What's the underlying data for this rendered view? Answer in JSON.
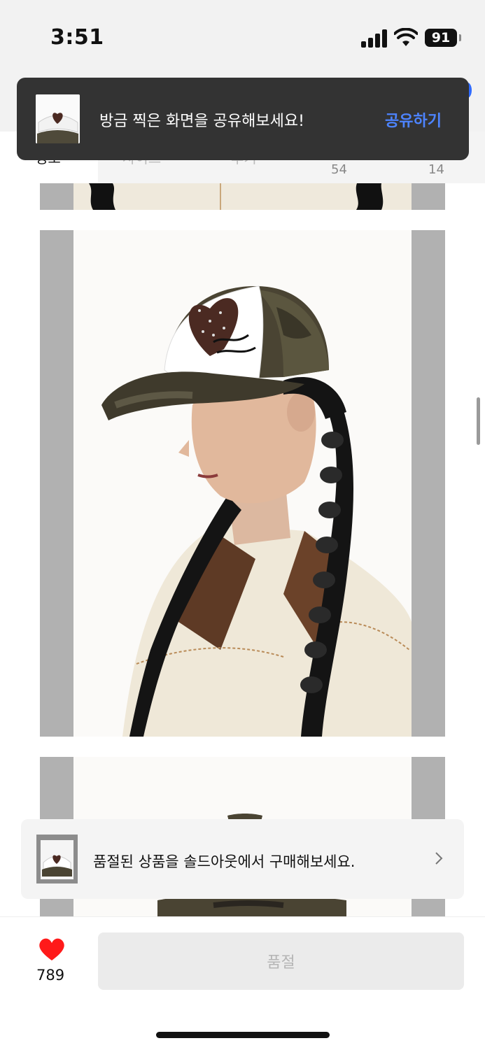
{
  "status_bar": {
    "time": "3:51",
    "battery": "91"
  },
  "tabs": {
    "info_partial": "정보",
    "size_partial": "사이즈",
    "review_partial": "후기",
    "count_a": "54",
    "count_b": "14"
  },
  "toast": {
    "message": "방금 찍은 화면을 공유해보세요!",
    "action": "공유하기"
  },
  "banner": {
    "text": "품절된 상품을 솔드아웃에서 구매해보세요."
  },
  "bottom": {
    "likes": "789",
    "soldout_button": "품절"
  },
  "colors": {
    "toast_bg": "#333333",
    "accent_blue": "#4d84ff",
    "heart": "#ff1a1a"
  },
  "icons": [
    "signal-icon",
    "wifi-icon",
    "battery-icon",
    "heart-icon",
    "chevron-right-icon"
  ]
}
